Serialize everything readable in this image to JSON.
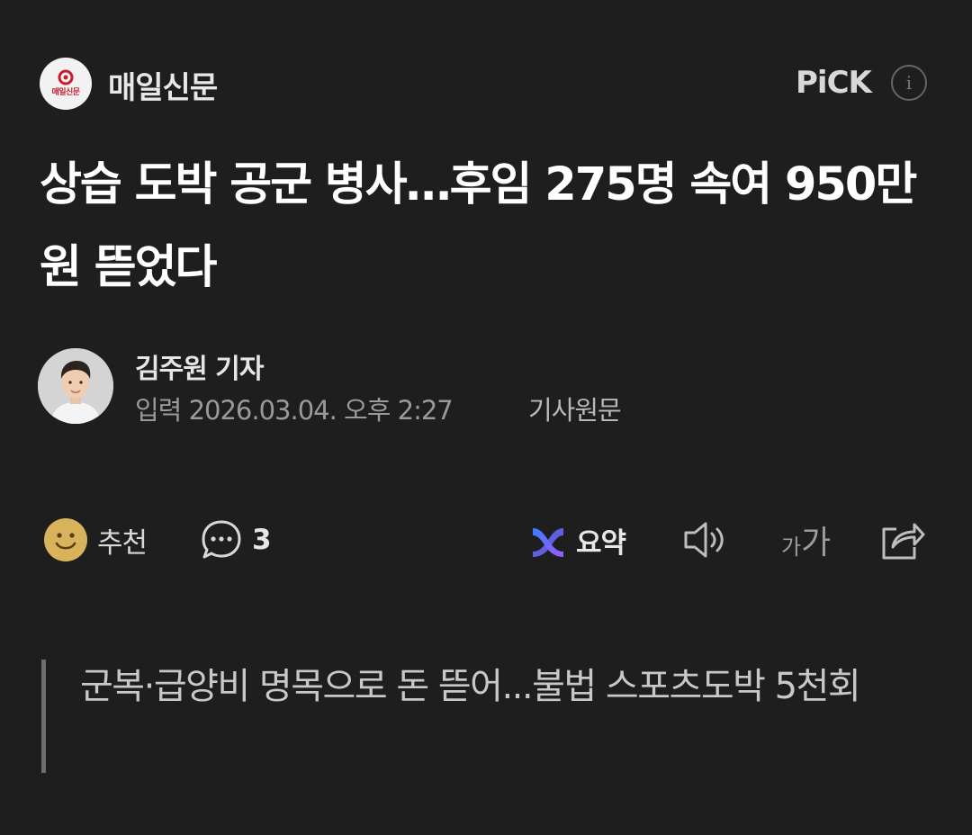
{
  "press": {
    "logo_text": "매일신문",
    "name": "매일신문",
    "pick_label": "PiCK",
    "info_icon": "info-icon"
  },
  "article": {
    "headline": "상습 도박 공군 병사…후임 275명 속여 950만원 뜯었다",
    "author": "김주원 기자",
    "published": "입력 2026.03.04. 오후 2:27",
    "original_link": "기사원문"
  },
  "toolbar": {
    "recommend_label": "추천",
    "comment_count": "3",
    "summary_label": "요약",
    "font_size_small": "가",
    "font_size_large": "가",
    "icons": [
      "smile-icon",
      "comment-icon",
      "summary-icon",
      "speaker-icon",
      "share-icon"
    ]
  },
  "subheadline": "군복·급양비 명목으로 돈 뜯어...불법 스포츠도박 5천회",
  "colors": {
    "background": "#1e1e1e",
    "summary_gradient": [
      "#3a7bff",
      "#9b5cff"
    ],
    "smile_yellow": "#d9b25c"
  }
}
